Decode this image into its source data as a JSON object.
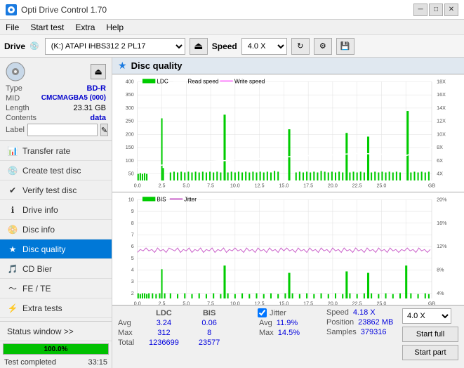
{
  "titlebar": {
    "title": "Opti Drive Control 1.70",
    "minimize": "─",
    "maximize": "□",
    "close": "✕"
  },
  "menu": {
    "items": [
      "File",
      "Start test",
      "Extra",
      "Help"
    ]
  },
  "toolbar": {
    "drive_label": "Drive",
    "drive_value": "(K:) ATAPI iHBS312  2 PL17",
    "speed_label": "Speed",
    "speed_value": "4.0 X"
  },
  "disc": {
    "type_label": "Type",
    "type_value": "BD-R",
    "mid_label": "MID",
    "mid_value": "CMCMAGBA5 (000)",
    "length_label": "Length",
    "length_value": "23.31 GB",
    "contents_label": "Contents",
    "contents_value": "data",
    "label_label": "Label",
    "label_value": ""
  },
  "nav": {
    "items": [
      {
        "id": "transfer-rate",
        "label": "Transfer rate",
        "icon": "chart"
      },
      {
        "id": "create-test-disc",
        "label": "Create test disc",
        "icon": "disc"
      },
      {
        "id": "verify-test-disc",
        "label": "Verify test disc",
        "icon": "check"
      },
      {
        "id": "drive-info",
        "label": "Drive info",
        "icon": "info"
      },
      {
        "id": "disc-info",
        "label": "Disc info",
        "icon": "disc2"
      },
      {
        "id": "disc-quality",
        "label": "Disc quality",
        "icon": "quality",
        "active": true
      },
      {
        "id": "cd-bier",
        "label": "CD Bier",
        "icon": "cd"
      },
      {
        "id": "fe-te",
        "label": "FE / TE",
        "icon": "fe"
      },
      {
        "id": "extra-tests",
        "label": "Extra tests",
        "icon": "extra"
      }
    ]
  },
  "status": {
    "label": "Status window >>",
    "progress": 100.0,
    "progress_text": "100.0%",
    "status_text": "Test completed",
    "time": "33:15"
  },
  "quality": {
    "title": "Disc quality",
    "legend_ldc": "LDC",
    "legend_read": "Read speed",
    "legend_write": "Write speed",
    "legend_bis": "BIS",
    "legend_jitter": "Jitter"
  },
  "stats": {
    "headers": [
      "LDC",
      "BIS"
    ],
    "avg_label": "Avg",
    "avg_ldc": "3.24",
    "avg_bis": "0.06",
    "max_label": "Max",
    "max_ldc": "312",
    "max_bis": "8",
    "total_label": "Total",
    "total_ldc": "1236699",
    "total_bis": "23577",
    "jitter_label": "Jitter",
    "jitter_avg": "11.9%",
    "jitter_max": "14.5%",
    "speed_label": "Speed",
    "speed_value": "4.18 X",
    "position_label": "Position",
    "position_value": "23862 MB",
    "samples_label": "Samples",
    "samples_value": "379316",
    "speed_select": "4.0 X",
    "btn_start_full": "Start full",
    "btn_start_part": "Start part"
  }
}
